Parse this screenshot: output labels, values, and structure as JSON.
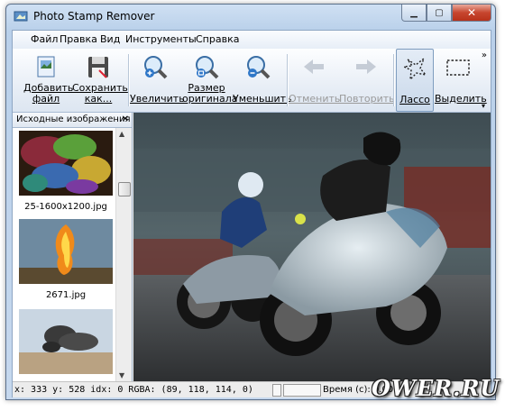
{
  "window": {
    "title": "Photo Stamp Remover",
    "min_label": "▁",
    "max_label": "▢",
    "close_label": "✕"
  },
  "menu": [
    "Файл",
    "Правка",
    "Вид",
    "Инструменты",
    "Справка"
  ],
  "toolbar": {
    "add_file": "Добавить файл",
    "save_as": "Сохранить как...",
    "zoom_in": "Увеличить",
    "original_size": "Размер оригинала",
    "zoom_out": "Уменьшить",
    "undo": "Отменить",
    "redo": "Повторить",
    "lasso": "Лассо",
    "select": "Выделить",
    "overflow": "»"
  },
  "panel": {
    "title": "Исходные изображения",
    "close": "✕",
    "thumbnails": [
      {
        "caption": "25-1600x1200.jpg"
      },
      {
        "caption": "2671.jpg"
      },
      {
        "caption": ""
      }
    ]
  },
  "status": {
    "coords": "x: 333 y: 528  idx: 0  RGBA: (89, 118, 114, 0)",
    "time": "Время (с): 0.000"
  },
  "watermark": "OWER.RU",
  "colors": {
    "titlebar": "#c6d8ee",
    "close_button": "#c7452e",
    "lasso_active": "#c9d8ea"
  }
}
